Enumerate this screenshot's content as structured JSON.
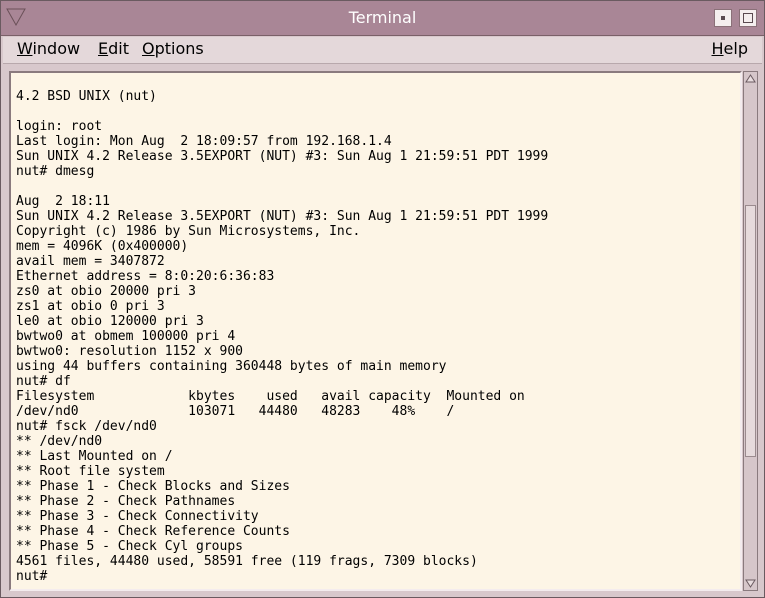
{
  "window": {
    "title": "Terminal"
  },
  "menubar": {
    "window": {
      "accel": "W",
      "rest": "indow"
    },
    "edit": {
      "accel": "E",
      "rest": "dit"
    },
    "options": {
      "accel": "O",
      "rest": "ptions"
    },
    "help": {
      "accel": "H",
      "rest": "elp"
    }
  },
  "terminal": {
    "lines": [
      "4.2 BSD UNIX (nut)",
      "",
      "login: root",
      "Last login: Mon Aug  2 18:09:57 from 192.168.1.4",
      "Sun UNIX 4.2 Release 3.5EXPORT (NUT) #3: Sun Aug 1 21:59:51 PDT 1999",
      "nut# dmesg",
      "",
      "Aug  2 18:11",
      "Sun UNIX 4.2 Release 3.5EXPORT (NUT) #3: Sun Aug 1 21:59:51 PDT 1999",
      "Copyright (c) 1986 by Sun Microsystems, Inc.",
      "mem = 4096K (0x400000)",
      "avail mem = 3407872",
      "Ethernet address = 8:0:20:6:36:83",
      "zs0 at obio 20000 pri 3",
      "zs1 at obio 0 pri 3",
      "le0 at obio 120000 pri 3",
      "bwtwo0 at obmem 100000 pri 4",
      "bwtwo0: resolution 1152 x 900",
      "using 44 buffers containing 360448 bytes of main memory",
      "nut# df",
      "Filesystem            kbytes    used   avail capacity  Mounted on",
      "/dev/nd0              103071   44480   48283    48%    /",
      "nut# fsck /dev/nd0",
      "** /dev/nd0",
      "** Last Mounted on /",
      "** Root file system",
      "** Phase 1 - Check Blocks and Sizes",
      "** Phase 2 - Check Pathnames",
      "** Phase 3 - Check Connectivity",
      "** Phase 4 - Check Reference Counts",
      "** Phase 5 - Check Cyl groups",
      "4561 files, 44480 used, 58591 free (119 frags, 7309 blocks)",
      "nut#"
    ]
  },
  "scrollbar": {
    "position": 0.5
  },
  "colors": {
    "titlebar": "#a98696",
    "terminal_bg": "#fdf5e6",
    "frame": "#d8c8cc"
  }
}
